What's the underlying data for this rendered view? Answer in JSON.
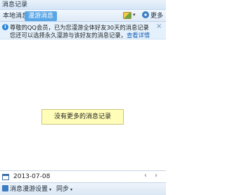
{
  "window": {
    "title": "消息记录"
  },
  "tabs": {
    "local": "本地消息",
    "roaming": "漫游消息"
  },
  "toolbar": {
    "more": "更多",
    "dropdown_caret": "▾"
  },
  "notice": {
    "line1": "尊敬的QQ会员，已为您漫游全体好友30天的消息记录",
    "line2_prefix": "您还可以选择永久漫游与该好友的消息记录，",
    "line2_link": "查看详情",
    "info_glyph": "i",
    "close": "×"
  },
  "records": {
    "empty_message": "没有更多的消息记录"
  },
  "datebar": {
    "date": "2013-07-08",
    "prev": "‹",
    "next": "›"
  },
  "bottombar": {
    "roam_settings": "消息漫游设置",
    "sync": "同步",
    "caret": "▾"
  },
  "colors": {
    "accent": "#5aa6e5",
    "notice_bg": "#e4f1fc",
    "empty_box_bg": "#fffdb8",
    "link": "#1a5fb4"
  }
}
